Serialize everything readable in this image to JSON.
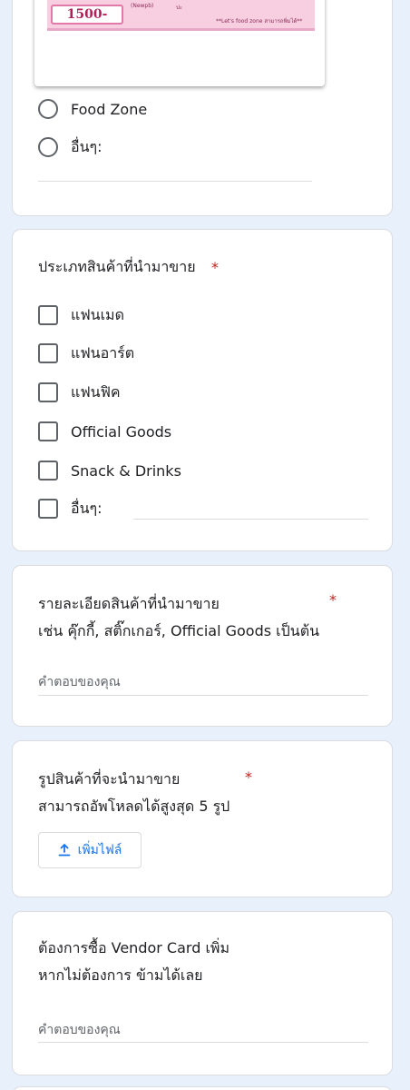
{
  "banner": {
    "price": "1500-",
    "small_text_1": "(Newpb)",
    "small_text_2": "ปะ",
    "small_text_3": "**Let's food zone สามารถพิ่มได้**"
  },
  "store_zone": {
    "options": [
      "Food Zone",
      "อื่นๆ:"
    ]
  },
  "product_type": {
    "title": "ประเภทสินค้าที่นำมาขาย",
    "required": "*",
    "options": [
      "แฟนเมด",
      "แฟนอาร์ต",
      "แฟนฟิค",
      "Official Goods",
      "Snack & Drinks",
      "อื่นๆ:"
    ]
  },
  "product_details": {
    "title_line1": "รายละเอียดสินค้าที่นำมาขาย",
    "title_line2": "เช่น คุ๊กกี้, สติ๊กเกอร์, Official Goods เป็นต้น",
    "required": "*",
    "placeholder": "คำตอบของคุณ"
  },
  "product_photos": {
    "title_line1": "รูปสินค้าที่จะนำมาขาย",
    "title_line2": "สามารถอัพโหลดได้สูงสุด 5 รูป",
    "required": "*",
    "upload_label": "เพิ่มไฟล์"
  },
  "vendor_card": {
    "title_line1": "ต้องการซื้อ Vendor Card เพิ่ม",
    "title_line2": "หากไม่ต้องการ ข้ามได้เลย",
    "placeholder": "คำตอบของคุณ"
  },
  "colors": {
    "background": "#e8f0fb",
    "accent": "#1a73e8",
    "required": "#c5221f"
  }
}
